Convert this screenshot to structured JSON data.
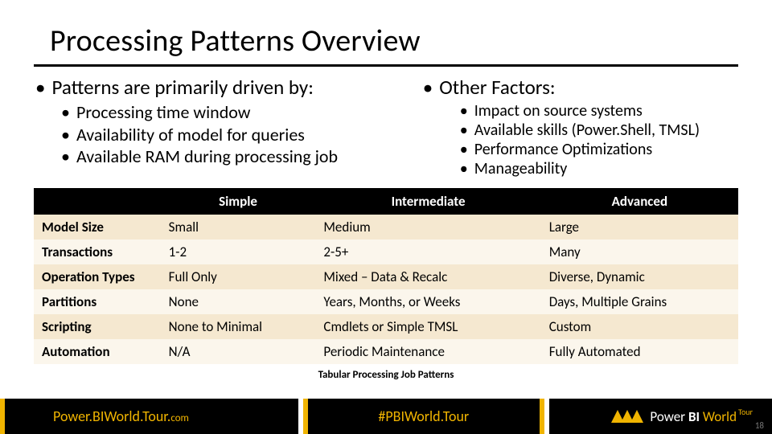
{
  "title": "Processing Patterns Overview",
  "left": {
    "heading": "Patterns are primarily driven by:",
    "items": [
      "Processing time window",
      "Availability of model for queries",
      "Available RAM during processing job"
    ]
  },
  "right": {
    "heading": "Other Factors:",
    "items": [
      "Impact on source systems",
      "Available skills (Power.Shell, TMSL)",
      "Performance Optimizations",
      "Manageability"
    ]
  },
  "table": {
    "headers": [
      "",
      "Simple",
      "Intermediate",
      "Advanced"
    ],
    "rows": [
      [
        "Model Size",
        "Small",
        "Medium",
        "Large"
      ],
      [
        "Transactions",
        "1-2",
        "2-5+",
        "Many"
      ],
      [
        "Operation Types",
        "Full Only",
        "Mixed – Data & Recalc",
        "Diverse, Dynamic"
      ],
      [
        "Partitions",
        "None",
        "Years, Months, or Weeks",
        "Days, Multiple Grains"
      ],
      [
        "Scripting",
        "None to Minimal",
        "Cmdlets or Simple TMSL",
        "Custom"
      ],
      [
        "Automation",
        "N/A",
        "Periodic Maintenance",
        "Fully Automated"
      ]
    ],
    "caption": "Tabular Processing Job Patterns"
  },
  "footer": {
    "brand_main": "Power.BIWorld.Tour.",
    "brand_suffix": "com",
    "hashtag": "#PBIWorld.Tour",
    "logo_prefix": "Power ",
    "logo_bi": "BI",
    "logo_world": "World",
    "logo_tour": "Tour",
    "page": "18"
  }
}
